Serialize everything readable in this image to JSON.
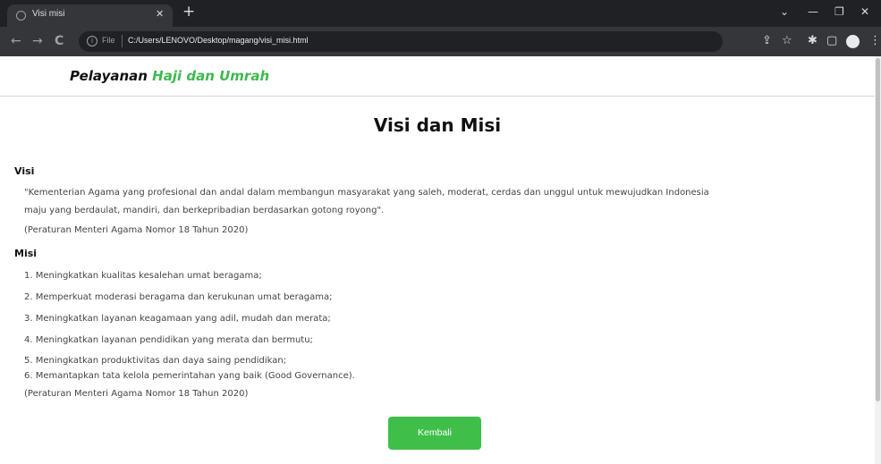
{
  "browser": {
    "tab_title": "Visi misi",
    "tab_close": "✕",
    "new_tab": "+",
    "minimize": "—",
    "maximize": "❐",
    "close": "✕",
    "back": "←",
    "forward": "→",
    "reload": "C",
    "info": "i",
    "scheme": "File",
    "url": "C:/Users/LENOVO/Desktop/magang/visi_misi.html",
    "share": "⇪",
    "star": "☆",
    "extensions": "✱",
    "sidepanel": "▢",
    "menu": "⋮"
  },
  "header": {
    "brand_prefix": "Pelayanan ",
    "brand_accent": "Haji dan Umrah",
    "accent_color": "#3fb950"
  },
  "main": {
    "title": "Visi dan Misi",
    "visi_heading": "Visi",
    "visi_line1": "\"Kementerian Agama yang profesional dan andal dalam membangun masyarakat yang saleh, moderat, cerdas dan unggul untuk mewujudkan Indonesia",
    "visi_line2": "maju yang berdaulat, mandiri, dan berkepribadian berdasarkan gotong royong\".",
    "visi_source": "(Peraturan Menteri Agama Nomor 18 Tahun 2020)",
    "misi_heading": "Misi",
    "misi_items": [
      "1. Meningkatkan kualitas kesalehan umat beragama;",
      "2. Memperkuat moderasi beragama dan kerukunan umat beragama;",
      "3. Meningkatkan layanan keagamaan yang adil, mudah dan merata;",
      "4. Meningkatkan layanan pendidikan yang merata dan bermutu;",
      "5. Meningkatkan produktivitas dan daya saing pendidikan;",
      "6. Memantapkan tata kelola pemerintahan yang baik (Good Governance)."
    ],
    "misi_source": "(Peraturan Menteri Agama Nomor 18 Tahun 2020)",
    "back_button": "Kembali",
    "button_color": "#3fbf4a"
  }
}
